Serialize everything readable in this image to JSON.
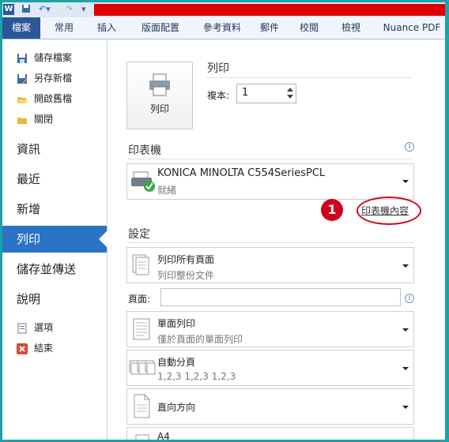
{
  "ribbon": {
    "tabs": [
      "檔案",
      "常用",
      "插入",
      "版面配置",
      "參考資料",
      "郵件",
      "校閱",
      "檢視",
      "Nuance PDF"
    ]
  },
  "nav": {
    "commands": [
      {
        "label": "儲存檔案",
        "icon": "save-icon"
      },
      {
        "label": "另存新檔",
        "icon": "save-as-icon"
      },
      {
        "label": "開啟舊檔",
        "icon": "open-folder-icon"
      },
      {
        "label": "關閉",
        "icon": "close-folder-icon"
      }
    ],
    "sections": [
      "資訊",
      "最近",
      "新增",
      "列印",
      "儲存並傳送",
      "說明"
    ],
    "active": "列印",
    "bottom_commands": [
      {
        "label": "選項",
        "icon": "options-icon"
      },
      {
        "label": "結束",
        "icon": "exit-icon"
      }
    ]
  },
  "print": {
    "title": "列印",
    "button_label": "列印",
    "copies_label": "複本:",
    "copies_value": "1"
  },
  "printer": {
    "section_title": "印表機",
    "name": "KONICA MINOLTA C554SeriesPCL",
    "status": "就緒",
    "properties_link": "印表機內容",
    "callout_number": "1"
  },
  "settings": {
    "section_title": "設定",
    "pages_label": "頁面:",
    "pages_value": "",
    "options": [
      {
        "line1": "列印所有頁面",
        "line2": "列印整份文件",
        "icon": "pages-icon"
      },
      {
        "line1": "單面列印",
        "line2": "僅於頁面的單面列印",
        "icon": "one-sided-icon"
      },
      {
        "line1": "自動分頁",
        "line2": "1,2,3    1,2,3    1,2,3",
        "icon": "collate-icon"
      },
      {
        "line1": "直向方向",
        "line2": "",
        "icon": "portrait-icon"
      },
      {
        "line1": "A4",
        "line2": "",
        "icon": "paper-size-icon"
      }
    ]
  },
  "colors": {
    "file_tab": "#2b5797",
    "active_nav": "#2b73c4",
    "callout": "#d0021b",
    "border": "#1aa3a8"
  }
}
